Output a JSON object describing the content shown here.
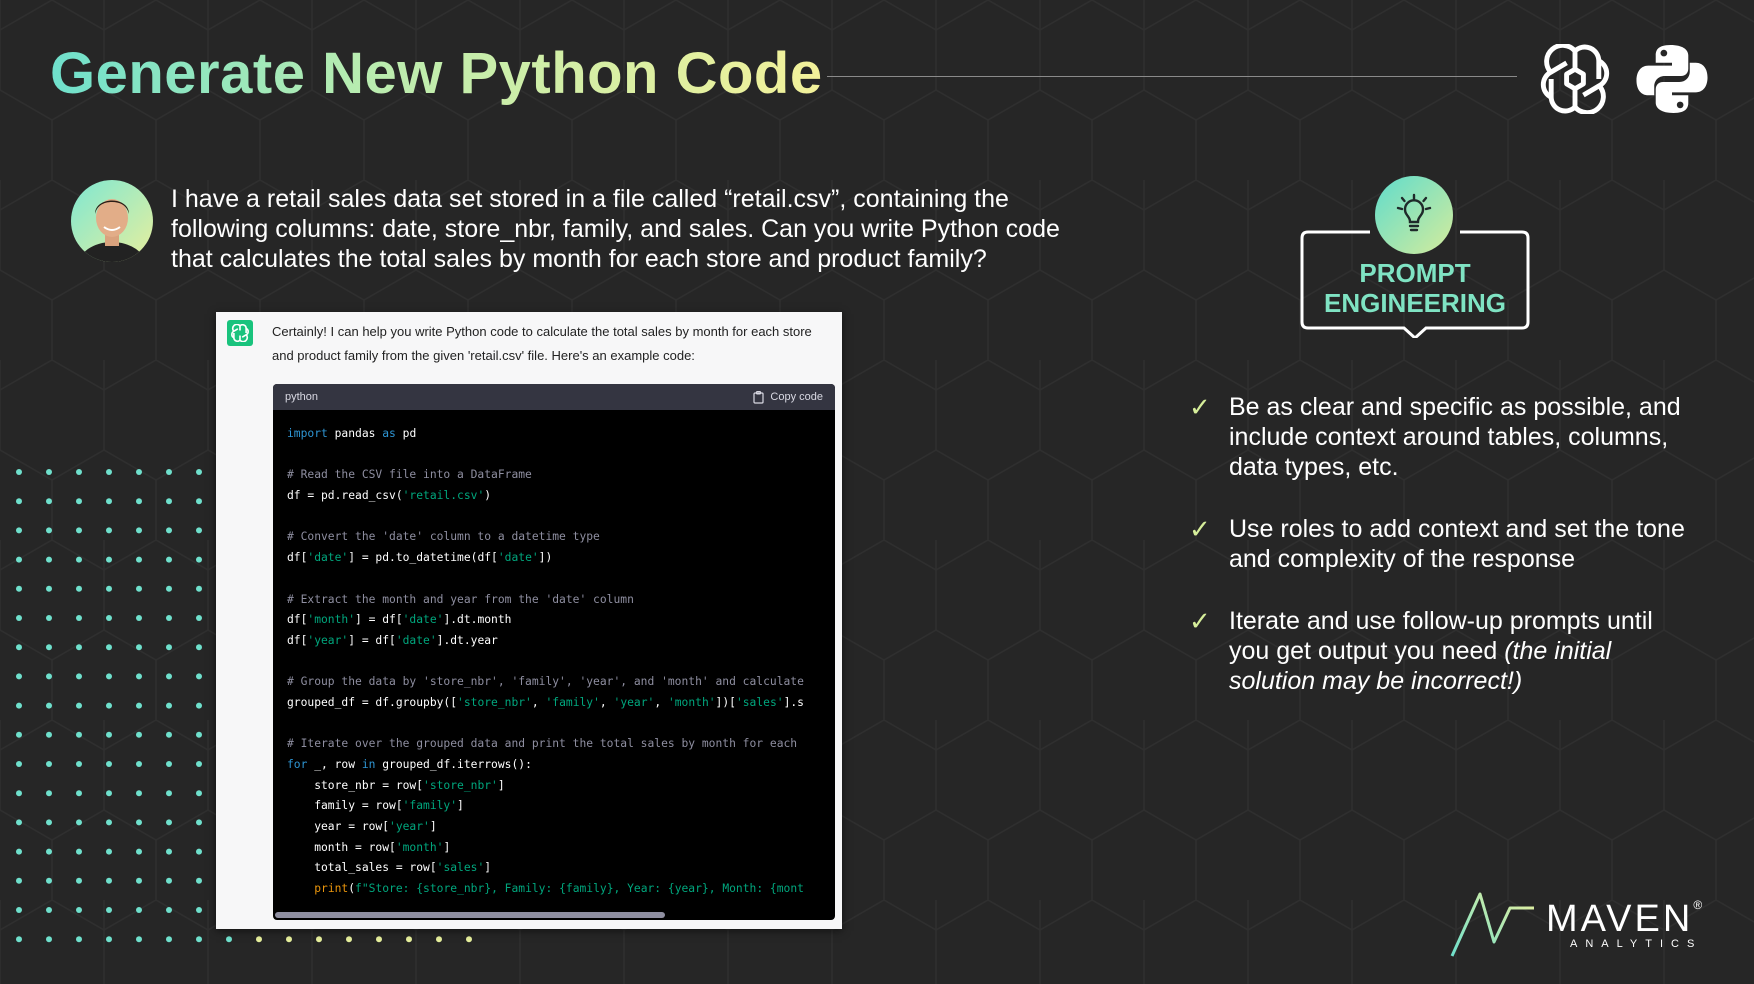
{
  "slide": {
    "title": "Generate New Python Code",
    "user_prompt": "I have a retail sales data set stored in a file called “retail.csv”, containing the following columns: date, store_nbr, family, and sales. Can you write Python code that calculates the total sales by month for each store and product family?"
  },
  "chat": {
    "answer": "Certainly! I can help you write Python code to calculate the total sales by month for each store and product family from the given 'retail.csv' file. Here's an example code:",
    "code_language": "python",
    "copy_label": "Copy code",
    "code_lines": [
      [
        {
          "t": "import",
          "c": "kw"
        },
        {
          "t": " pandas ",
          "c": "pl"
        },
        {
          "t": "as",
          "c": "kw"
        },
        {
          "t": " pd",
          "c": "pl"
        }
      ],
      [],
      [
        {
          "t": "# Read the CSV file into a DataFrame",
          "c": "cm"
        }
      ],
      [
        {
          "t": "df = pd.read_csv(",
          "c": "pl"
        },
        {
          "t": "'retail.csv'",
          "c": "st"
        },
        {
          "t": ")",
          "c": "pl"
        }
      ],
      [],
      [
        {
          "t": "# Convert the 'date' column to a datetime type",
          "c": "cm"
        }
      ],
      [
        {
          "t": "df[",
          "c": "pl"
        },
        {
          "t": "'date'",
          "c": "st"
        },
        {
          "t": "] = pd.to_datetime(df[",
          "c": "pl"
        },
        {
          "t": "'date'",
          "c": "st"
        },
        {
          "t": "])",
          "c": "pl"
        }
      ],
      [],
      [
        {
          "t": "# Extract the month and year from the 'date' column",
          "c": "cm"
        }
      ],
      [
        {
          "t": "df[",
          "c": "pl"
        },
        {
          "t": "'month'",
          "c": "st"
        },
        {
          "t": "] = df[",
          "c": "pl"
        },
        {
          "t": "'date'",
          "c": "st"
        },
        {
          "t": "].dt.month",
          "c": "pl"
        }
      ],
      [
        {
          "t": "df[",
          "c": "pl"
        },
        {
          "t": "'year'",
          "c": "st"
        },
        {
          "t": "] = df[",
          "c": "pl"
        },
        {
          "t": "'date'",
          "c": "st"
        },
        {
          "t": "].dt.year",
          "c": "pl"
        }
      ],
      [],
      [
        {
          "t": "# Group the data by 'store_nbr', 'family', 'year', and 'month' and calculate",
          "c": "cm"
        }
      ],
      [
        {
          "t": "grouped_df = df.groupby([",
          "c": "pl"
        },
        {
          "t": "'store_nbr'",
          "c": "st"
        },
        {
          "t": ", ",
          "c": "pl"
        },
        {
          "t": "'family'",
          "c": "st"
        },
        {
          "t": ", ",
          "c": "pl"
        },
        {
          "t": "'year'",
          "c": "st"
        },
        {
          "t": ", ",
          "c": "pl"
        },
        {
          "t": "'month'",
          "c": "st"
        },
        {
          "t": "])[",
          "c": "pl"
        },
        {
          "t": "'sales'",
          "c": "st"
        },
        {
          "t": "].s",
          "c": "pl"
        }
      ],
      [],
      [
        {
          "t": "# Iterate over the grouped data and print the total sales by month for each",
          "c": "cm"
        }
      ],
      [
        {
          "t": "for",
          "c": "kw"
        },
        {
          "t": " _, row ",
          "c": "pl"
        },
        {
          "t": "in",
          "c": "kw"
        },
        {
          "t": " grouped_df.iterrows():",
          "c": "pl"
        }
      ],
      [
        {
          "t": "    store_nbr = row[",
          "c": "pl"
        },
        {
          "t": "'store_nbr'",
          "c": "st"
        },
        {
          "t": "]",
          "c": "pl"
        }
      ],
      [
        {
          "t": "    family = row[",
          "c": "pl"
        },
        {
          "t": "'family'",
          "c": "st"
        },
        {
          "t": "]",
          "c": "pl"
        }
      ],
      [
        {
          "t": "    year = row[",
          "c": "pl"
        },
        {
          "t": "'year'",
          "c": "st"
        },
        {
          "t": "]",
          "c": "pl"
        }
      ],
      [
        {
          "t": "    month = row[",
          "c": "pl"
        },
        {
          "t": "'month'",
          "c": "st"
        },
        {
          "t": "]",
          "c": "pl"
        }
      ],
      [
        {
          "t": "    total_sales = row[",
          "c": "pl"
        },
        {
          "t": "'sales'",
          "c": "st"
        },
        {
          "t": "]",
          "c": "pl"
        }
      ],
      [
        {
          "t": "    ",
          "c": "pl"
        },
        {
          "t": "print",
          "c": "fn"
        },
        {
          "t": "(",
          "c": "pl"
        },
        {
          "t": "f\"Store: {store_nbr}, Family: {family}, Year: {year}, Month: {mont",
          "c": "st"
        }
      ]
    ]
  },
  "badge": {
    "line1": "PROMPT",
    "line2": "ENGINEERING",
    "icon": "lightbulb-icon"
  },
  "tips": [
    {
      "text": "Be as clear and specific as possible, and include context around tables, columns, data types, etc.",
      "italic": ""
    },
    {
      "text": "Use roles to add context and set the tone and complexity of the response",
      "italic": ""
    },
    {
      "text": "Iterate and use follow-up prompts until you get output you need ",
      "italic": "(the initial solution may be incorrect!)"
    }
  ],
  "brand": {
    "name": "MAVEN",
    "reg": "®",
    "sub": "ANALYTICS"
  },
  "colors": {
    "background": "#262626",
    "title_gradient_start": "#6fe0cc",
    "title_gradient_end": "#f3f19a",
    "check": "#d6ee9a",
    "badge_text": "#7fe3c3",
    "code_keyword": "#2e95d3",
    "code_string": "#00a67d",
    "code_comment": "#8e8ea0",
    "code_function": "#e9950c"
  }
}
